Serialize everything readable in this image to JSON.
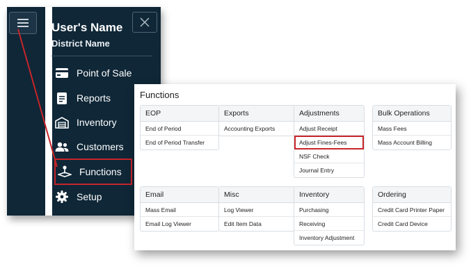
{
  "nav": {
    "user_name": "User's Name",
    "district_name": "District Name",
    "items": [
      {
        "label": "Point of Sale",
        "icon": "credit-card-icon"
      },
      {
        "label": "Reports",
        "icon": "document-icon"
      },
      {
        "label": "Inventory",
        "icon": "warehouse-icon"
      },
      {
        "label": "Customers",
        "icon": "users-icon"
      },
      {
        "label": "Functions",
        "icon": "joystick-icon",
        "active": true
      },
      {
        "label": "Setup",
        "icon": "gear-icon"
      }
    ],
    "colors": {
      "background": "#0f2737",
      "highlight": "#c7252a"
    }
  },
  "functions": {
    "title": "Functions",
    "groups": [
      {
        "header": "EOP",
        "items": [
          "End of Period",
          "End of Period Transfer"
        ]
      },
      {
        "header": "Exports",
        "items": [
          "Accounting Exports"
        ]
      },
      {
        "header": "Adjustments",
        "items": [
          "Adjust Receipt",
          "Adjust Fines-Fees",
          "NSF Check",
          "Journal Entry"
        ]
      },
      {
        "header": "Bulk Operations",
        "items": [
          "Mass Fees",
          "Mass Account Billing"
        ]
      },
      {
        "header": "Email",
        "items": [
          "Mass Email",
          "Email Log Viewer"
        ]
      },
      {
        "header": "Misc",
        "items": [
          "Log Viewer",
          "Edit Item Data"
        ]
      },
      {
        "header": "Inventory",
        "items": [
          "Purchasing",
          "Receiving",
          "Inventory Adjustment"
        ]
      },
      {
        "header": "Ordering",
        "items": [
          "Credit Card Printer Paper",
          "Credit Card Device"
        ]
      }
    ],
    "highlighted_item": "Adjust Fines-Fees"
  }
}
